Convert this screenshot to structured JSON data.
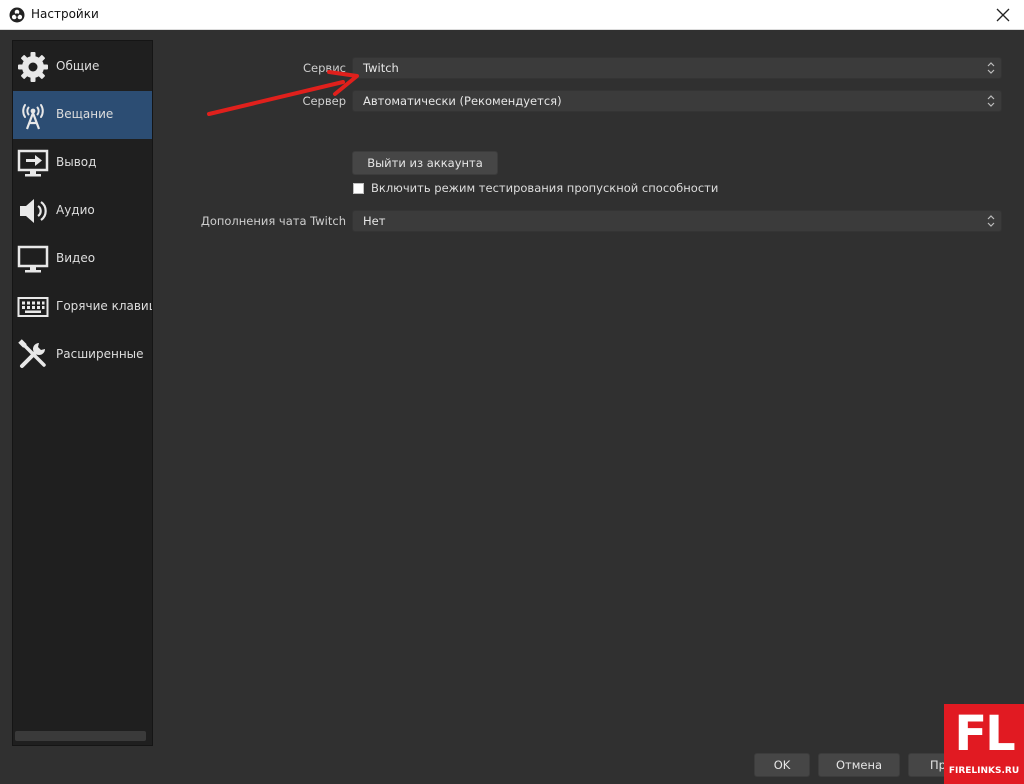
{
  "window": {
    "title": "Настройки"
  },
  "sidebar": {
    "items": [
      {
        "label": "Общие",
        "icon": "gear-icon"
      },
      {
        "label": "Вещание",
        "icon": "broadcast-icon"
      },
      {
        "label": "Вывод",
        "icon": "output-icon"
      },
      {
        "label": "Аудио",
        "icon": "speaker-icon"
      },
      {
        "label": "Видео",
        "icon": "monitor-icon"
      },
      {
        "label": "Горячие клавиши",
        "icon": "keyboard-icon"
      },
      {
        "label": "Расширенные",
        "icon": "tools-icon"
      }
    ],
    "active_index": 1
  },
  "stream": {
    "service_label": "Сервис",
    "service_value": "Twitch",
    "server_label": "Сервер",
    "server_value": "Автоматически (Рекомендуется)",
    "logout_button": "Выйти из аккаунта",
    "bandwidth_test_label": "Включить режим тестирования пропускной способности",
    "bandwidth_test_checked": false,
    "chat_addons_label": "Дополнения чата Twitch",
    "chat_addons_value": "Нет"
  },
  "footer": {
    "ok_label": "OK",
    "cancel_label": "Отмена",
    "apply_label": "Пр"
  },
  "watermark": {
    "logo_text": "FL",
    "site_text": "FIRELINKS.RU"
  },
  "colors": {
    "accent": "#2c4d73",
    "arrow": "#e0201c",
    "badge": "#e11a22"
  }
}
